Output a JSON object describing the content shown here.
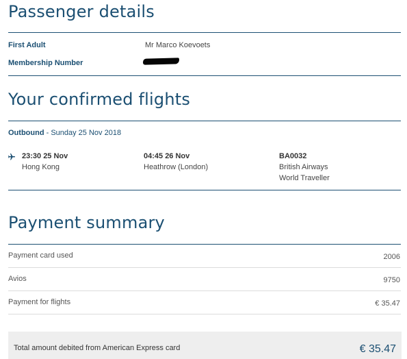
{
  "passenger": {
    "title": "Passenger details",
    "first_adult_label": "First Adult",
    "first_adult_value": "Mr Marco Koevoets",
    "membership_label": "Membership Number"
  },
  "flights": {
    "title": "Your confirmed flights",
    "outbound_label": "Outbound",
    "outbound_date": " - Sunday 25 Nov 2018",
    "icon": "plane-icon",
    "departure_time": "23:30 25 Nov",
    "departure_place": "Hong Kong",
    "arrival_time": "04:45 26 Nov",
    "arrival_place": "Heathrow (London)",
    "flight_number": "BA0032",
    "airline": "British Airways",
    "cabin": "World Traveller"
  },
  "payment": {
    "title": "Payment summary",
    "rows": [
      {
        "label": "Payment card used",
        "value": "2006"
      },
      {
        "label": "Avios",
        "value": "9750"
      },
      {
        "label": "Payment for flights",
        "value": "€ 35.47"
      }
    ],
    "total_label": "Total amount debited from American Express card",
    "total_value": "€ 35.47"
  },
  "colors": {
    "brand": "#1b4f72",
    "total_background": "#eeeeee"
  }
}
